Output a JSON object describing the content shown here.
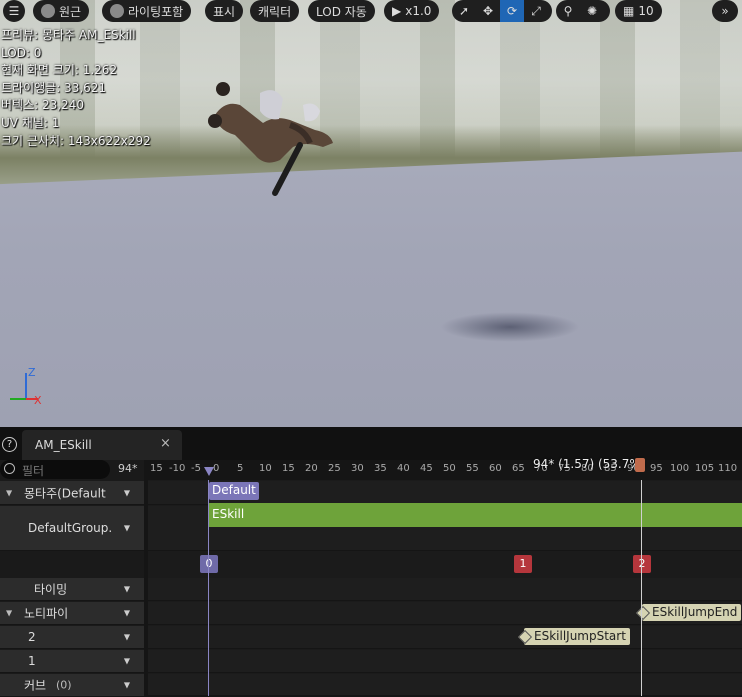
{
  "toolbar": {
    "menu_icon": "hamburger-icon",
    "perspective_label": "원근",
    "lighting_label": "라이팅포함",
    "show_label": "표시",
    "character_label": "캐릭터",
    "lod_label": "LOD 자동",
    "play_label": "x1.0",
    "grid_value": "10",
    "tools": [
      "select-icon",
      "translate-icon",
      "rotate-icon",
      "scale-icon",
      "camera-speed-icon",
      "snap-icon"
    ],
    "active_tool": "rotate-icon",
    "accent_color": "#1f66b5"
  },
  "stats": {
    "line1": "프리뷰: 몽타주 AM_ESkill",
    "line2": "LOD: 0",
    "line3": "현재 화면 크기: 1.262",
    "line4": "트라이앵글: 33,621",
    "line5": "버텍스: 23,240",
    "line6": "UV 채널: 1",
    "line7": "크기 근사치: 143x622x292"
  },
  "axis": {
    "z": "Z",
    "x": "X"
  },
  "panel": {
    "tab_label": "AM_ESkill",
    "close": "×",
    "help": "?",
    "filter_placeholder": "필터",
    "current_frame": "94*",
    "frame_info": "94* (1.57) (53.7%)",
    "rows": {
      "montage": "몽타주(Default",
      "group": "DefaultGroup.",
      "timing": "타이밍",
      "notify": "노티파이",
      "track2": "2",
      "track1": "1",
      "curve": "커브",
      "curve_count": "(0)"
    },
    "section_label": "Default",
    "slot_label": "ESkill",
    "markers": [
      "0",
      "1",
      "2"
    ],
    "notifies": {
      "end": "ESkillJumpEnd",
      "start": "ESkillJumpStart"
    },
    "ruler_ticks": [
      "15",
      "-10",
      "-5",
      "0",
      "5",
      "10",
      "15",
      "20",
      "25",
      "30",
      "35",
      "40",
      "45",
      "50",
      "55",
      "60",
      "65",
      "70",
      "75",
      "80",
      "85",
      "90",
      "95",
      "100",
      "105",
      "110"
    ],
    "colors": {
      "section": "#7b76b8",
      "slot": "#6ea33a",
      "marker_start": "#6f6aa8",
      "marker_mid": "#b5363c",
      "notify": "#d5d3b2"
    }
  }
}
